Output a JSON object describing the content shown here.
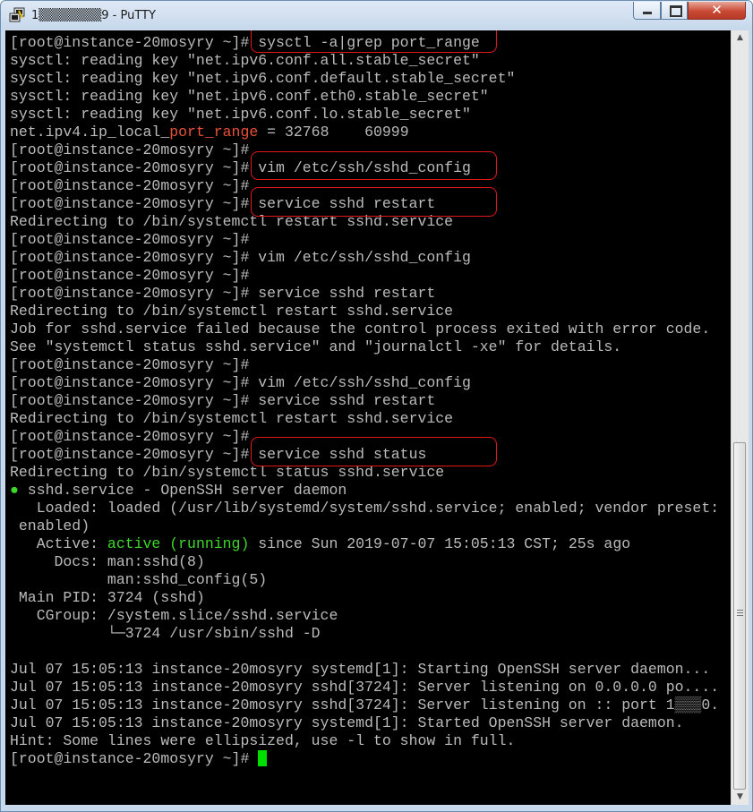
{
  "window": {
    "title": "1▒▒▒▒▒▒▒9 - PuTTY",
    "icon": "putty-icon",
    "controls": {
      "minimize": "minimize-icon",
      "maximize": "maximize-icon",
      "close": "✕"
    }
  },
  "terminal": {
    "background": "#000000",
    "text_color": "#bbbbbb",
    "highlight_color": "#e01818",
    "lines": [
      [
        {
          "t": "[root@instance-20mosyry ~]# sysctl -a|grep port_range"
        }
      ],
      [
        {
          "t": "sysctl: reading key \"net.ipv6.conf.all.stable_secret\""
        }
      ],
      [
        {
          "t": "sysctl: reading key \"net.ipv6.conf.default.stable_secret\""
        }
      ],
      [
        {
          "t": "sysctl: reading key \"net.ipv6.conf.eth0.stable_secret\""
        }
      ],
      [
        {
          "t": "sysctl: reading key \"net.ipv6.conf.lo.stable_secret\""
        }
      ],
      [
        {
          "t": "net.ipv4.ip_local_"
        },
        {
          "t": "port_range",
          "c": "red"
        },
        {
          "t": " = 32768    60999"
        }
      ],
      [
        {
          "t": "[root@instance-20mosyry ~]#"
        }
      ],
      [
        {
          "t": "[root@instance-20mosyry ~]# vim /etc/ssh/sshd_config"
        }
      ],
      [
        {
          "t": "[root@instance-20mosyry ~]#"
        }
      ],
      [
        {
          "t": "[root@instance-20mosyry ~]# service sshd restart"
        }
      ],
      [
        {
          "t": "Redirecting to /bin/systemctl restart sshd.service"
        }
      ],
      [
        {
          "t": "[root@instance-20mosyry ~]#"
        }
      ],
      [
        {
          "t": "[root@instance-20mosyry ~]# vim /etc/ssh/sshd_config"
        }
      ],
      [
        {
          "t": "[root@instance-20mosyry ~]#"
        }
      ],
      [
        {
          "t": "[root@instance-20mosyry ~]# service sshd restart"
        }
      ],
      [
        {
          "t": "Redirecting to /bin/systemctl restart sshd.service"
        }
      ],
      [
        {
          "t": "Job for sshd.service failed because the control process exited with error code."
        }
      ],
      [
        {
          "t": "See \"systemctl status sshd.service\" and \"journalctl -xe\" for details."
        }
      ],
      [
        {
          "t": "[root@instance-20mosyry ~]#"
        }
      ],
      [
        {
          "t": "[root@instance-20mosyry ~]# vim /etc/ssh/sshd_config"
        }
      ],
      [
        {
          "t": "[root@instance-20mosyry ~]# service sshd restart"
        }
      ],
      [
        {
          "t": "Redirecting to /bin/systemctl restart sshd.service"
        }
      ],
      [
        {
          "t": "[root@instance-20mosyry ~]#"
        }
      ],
      [
        {
          "t": "[root@instance-20mosyry ~]# service sshd status"
        }
      ],
      [
        {
          "t": "Redirecting to /bin/systemctl status sshd.service"
        }
      ],
      [
        {
          "t": "●",
          "c": "green"
        },
        {
          "t": " sshd.service - OpenSSH server daemon"
        }
      ],
      [
        {
          "t": "   Loaded: loaded (/usr/lib/systemd/system/sshd.service; enabled; vendor preset:"
        }
      ],
      [
        {
          "t": " enabled)"
        }
      ],
      [
        {
          "t": "   Active: "
        },
        {
          "t": "active (running)",
          "c": "green"
        },
        {
          "t": " since Sun 2019-07-07 15:05:13 CST; 25s ago"
        }
      ],
      [
        {
          "t": "     Docs: man:sshd(8)"
        }
      ],
      [
        {
          "t": "           man:sshd_config(5)"
        }
      ],
      [
        {
          "t": " Main PID: 3724 (sshd)"
        }
      ],
      [
        {
          "t": "   CGroup: /system.slice/sshd.service"
        }
      ],
      [
        {
          "t": "           └─3724 /usr/sbin/sshd -D"
        }
      ],
      [
        {
          "t": ""
        }
      ],
      [
        {
          "t": "Jul 07 15:05:13 instance-20mosyry systemd[1]: Starting OpenSSH server daemon..."
        }
      ],
      [
        {
          "t": "Jul 07 15:05:13 instance-20mosyry sshd[3724]: Server listening on 0.0.0.0 po...."
        }
      ],
      [
        {
          "t": "Jul 07 15:05:13 instance-20mosyry sshd[3724]: Server listening on :: port 1▒▒▒0."
        }
      ],
      [
        {
          "t": "Jul 07 15:05:13 instance-20mosyry systemd[1]: Started OpenSSH server daemon."
        }
      ],
      [
        {
          "t": "Hint: Some lines were ellipsized, use -l to show in full."
        }
      ],
      [
        {
          "t": "[root@instance-20mosyry ~]# "
        },
        {
          "cursor": true
        }
      ]
    ],
    "annotations": [
      "sysctl -a|grep port_range",
      "vim /etc/ssh/sshd_config",
      "service sshd restart",
      "service sshd status"
    ]
  },
  "scrollbar": {
    "up": "▲",
    "down": "▼"
  }
}
